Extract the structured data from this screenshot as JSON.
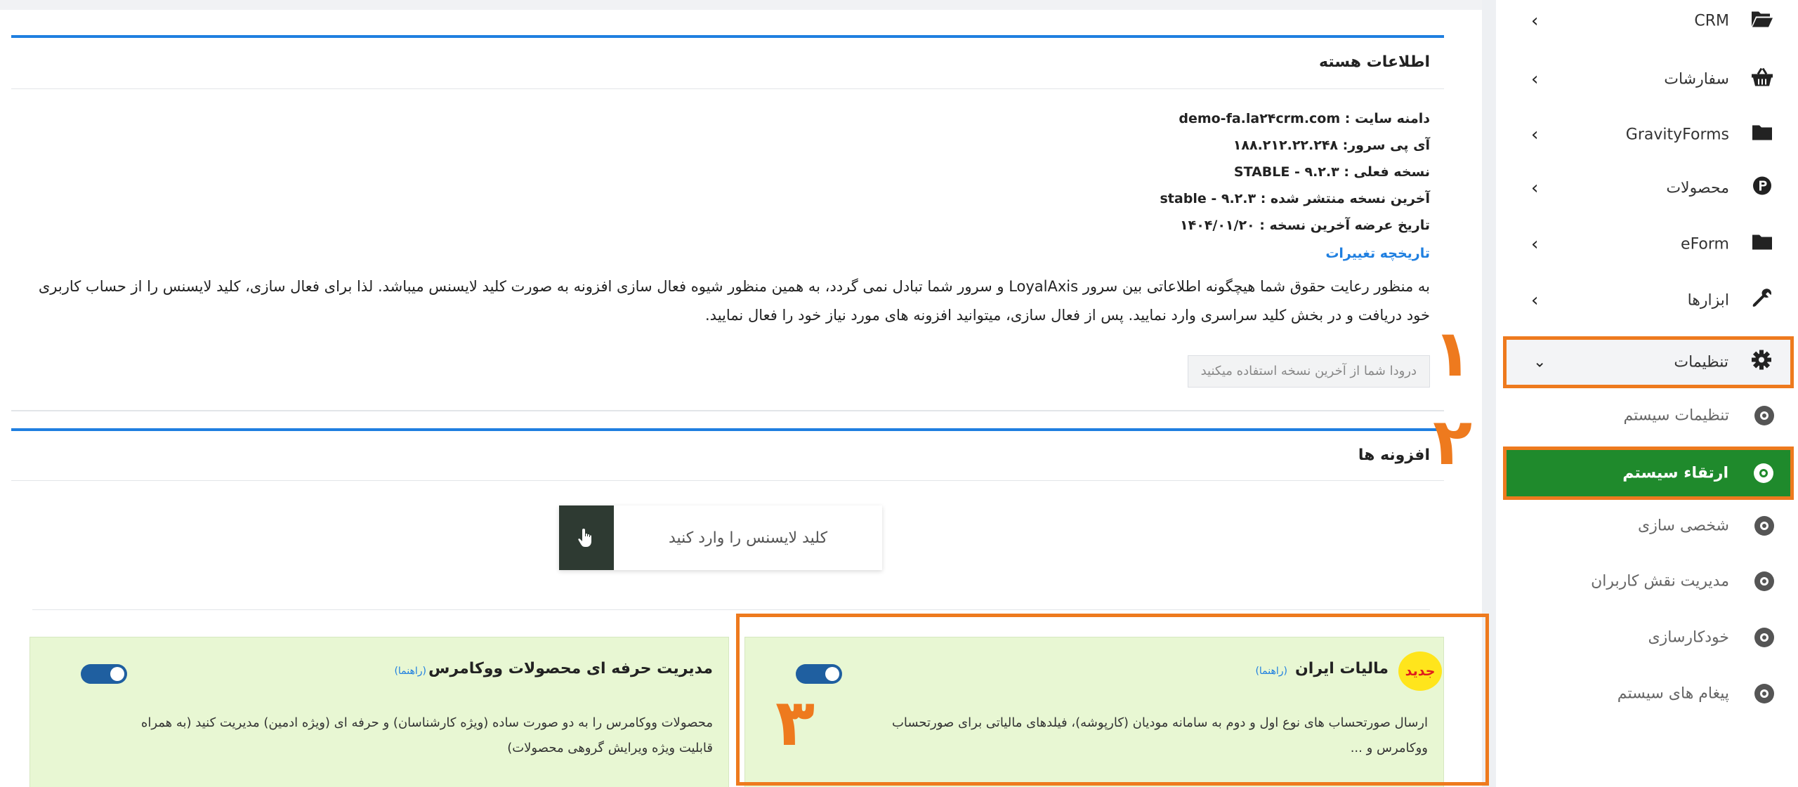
{
  "core_info": {
    "title": "اطلاعات هسته",
    "site_domain": "دامنه سایت : demo-fa.la۲۴crm.com",
    "server_ip": "آی پی سرور: ۱۸۸.۲۱۲.۲۲.۲۴۸",
    "current_version": "نسخه فعلی : ۹.۲.۳ - STABLE",
    "latest_version": "آخرین نسخه منتشر شده : ۹.۲.۳ - stable",
    "latest_release_date": "تاریخ عرضه آخرین نسخه : ۱۴۰۴/۰۱/۲۰",
    "changelog_link": "تاریخچه تغییرات",
    "description": "به منظور رعایت حقوق شما هیچگونه اطلاعاتی بین سرور LoyalAxis و سرور شما تبادل نمی گردد، به همین منظور شیوه فعال سازی افزونه به صورت کلید لایسنس میباشد. لذا برای فعال سازی، کلید لایسنس را از حساب کاربری خود دریافت و در بخش کلید سراسری وارد نمایید. پس از فعال سازی، میتوانید افزونه های مورد نیاز خود را فعال نمایید.",
    "latest_badge": "درودا شما از آخرین نسخه استفاده میکنید"
  },
  "addons": {
    "title": "افزونه ها",
    "license_placeholder": "کلید لایسنس را وارد کنید",
    "items": [
      {
        "name": "مالیات ایران",
        "guide": "(راهنما)",
        "badge": "جدید",
        "description": "ارسال صورتحساب های نوع اول و دوم به سامانه مودیان (کارپوشه)، فیلدهای مالیاتی برای صورتحساب ووکامرس و ...",
        "enabled": true
      },
      {
        "name": "مدیریت حرفه ای محصولات ووکامرس",
        "guide": "(راهنما)",
        "description": "محصولات ووکامرس را به دو صورت ساده (ویژه کارشناسان) و حرفه ای (ویژه ادمین) مدیریت کنید (به همراه قابلیت ویژه ویرایش گروهی محصولات)",
        "enabled": true
      }
    ]
  },
  "annotations": [
    "۱",
    "۲",
    "۳"
  ],
  "sidebar": {
    "items": [
      {
        "label": "CRM",
        "icon": "folder-open-icon"
      },
      {
        "label": "سفارشات",
        "icon": "basket-icon"
      },
      {
        "label": "GravityForms",
        "icon": "folder-icon"
      },
      {
        "label": "محصولات",
        "icon": "product-p-icon"
      },
      {
        "label": "eForm",
        "icon": "folder-icon"
      },
      {
        "label": "ابزارها",
        "icon": "wrench-icon"
      },
      {
        "label": "تنظیمات",
        "icon": "gear-icon"
      }
    ],
    "settings_sub": [
      {
        "label": "تنظیمات سیستم"
      },
      {
        "label": "ارتقاء سیستم",
        "active": true
      },
      {
        "label": "شخصی سازی"
      },
      {
        "label": "مدیریت نقش کاربران"
      },
      {
        "label": "خودکارسازی"
      },
      {
        "label": "پیغام های سیستم"
      }
    ]
  },
  "colors": {
    "accent_blue": "#1f7fe0",
    "active_green": "#1f8a2c",
    "annotation_orange": "#ee7a1e",
    "addon_bg": "#e8f7d3",
    "new_badge": "#ffe51c"
  }
}
